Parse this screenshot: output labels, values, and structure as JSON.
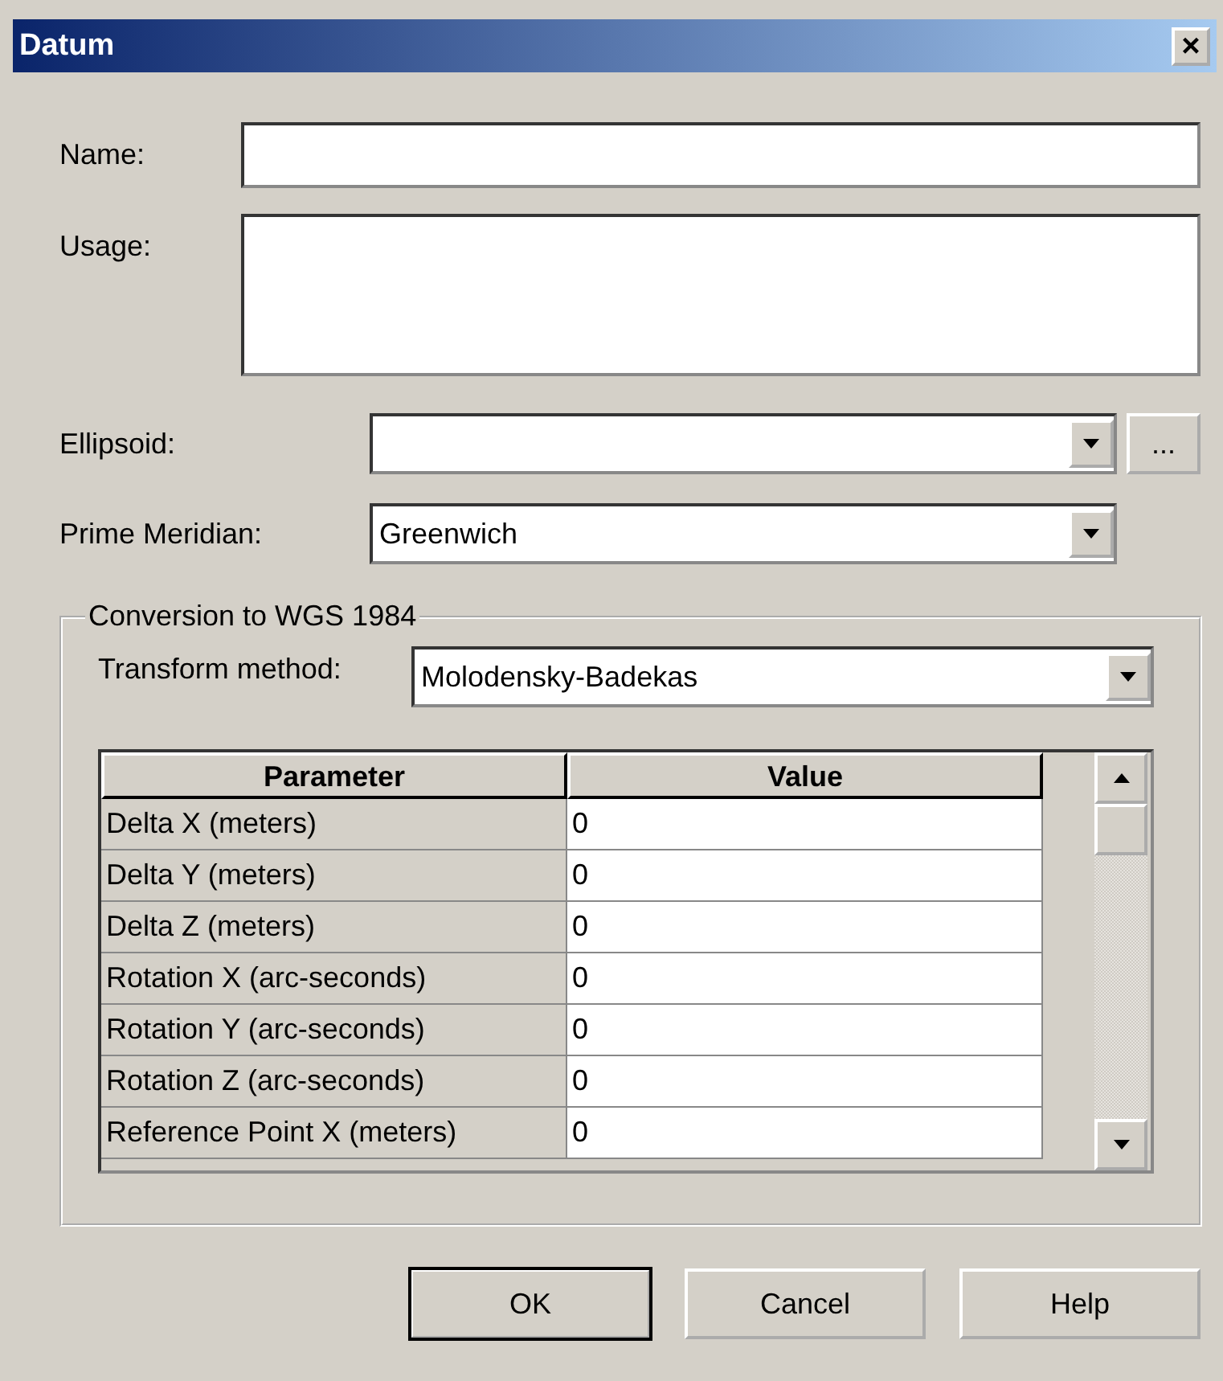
{
  "window": {
    "title": "Datum",
    "close": "×"
  },
  "name": {
    "label": "Name:"
  },
  "usage": {
    "label": "Usage:"
  },
  "ellipsoid": {
    "label": "Ellipsoid:",
    "browse": "..."
  },
  "prime_meridian": {
    "label": "Prime Meridian:",
    "value": "Greenwich"
  },
  "conversion": {
    "title": "Conversion to WGS 1984",
    "transform_method": {
      "label": "Transform method:",
      "value": "Molodensky-Badekas"
    },
    "table": {
      "columns": [
        "Parameter",
        "Value"
      ],
      "rows": [
        {
          "parameter": "Delta X (meters)",
          "value": "0"
        },
        {
          "parameter": "Delta Y (meters)",
          "value": "0"
        },
        {
          "parameter": "Delta Z (meters)",
          "value": "0"
        },
        {
          "parameter": "Rotation X (arc-seconds)",
          "value": "0"
        },
        {
          "parameter": "Rotation Y (arc-seconds)",
          "value": "0"
        },
        {
          "parameter": "Rotation Z (arc-seconds)",
          "value": "0"
        },
        {
          "parameter": "Reference Point X (meters)",
          "value": "0"
        }
      ]
    }
  },
  "buttons": [
    {
      "label": "OK",
      "default": true
    },
    {
      "label": "Cancel",
      "default": false
    },
    {
      "label": "Help",
      "default": false
    }
  ]
}
